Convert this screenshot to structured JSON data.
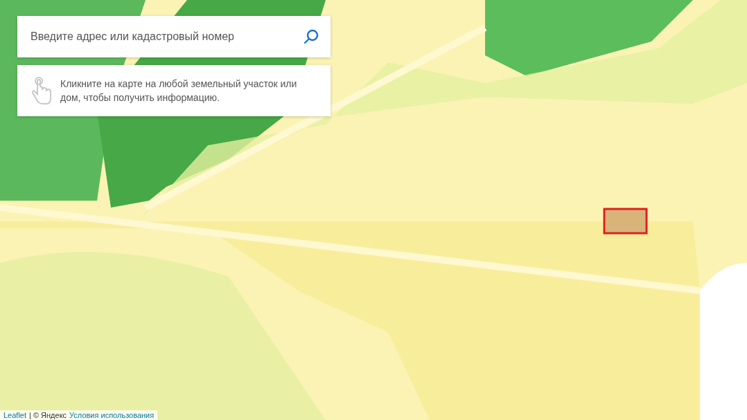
{
  "search": {
    "placeholder": "Введите адрес или кадастровый номер"
  },
  "hint": {
    "text": "Кликните на карте на любой земельный участок или дом, чтобы получить информацию."
  },
  "attribution": {
    "library": "Leaflet",
    "copyright": "| © Яндекс",
    "terms_link": "Условия использования"
  }
}
